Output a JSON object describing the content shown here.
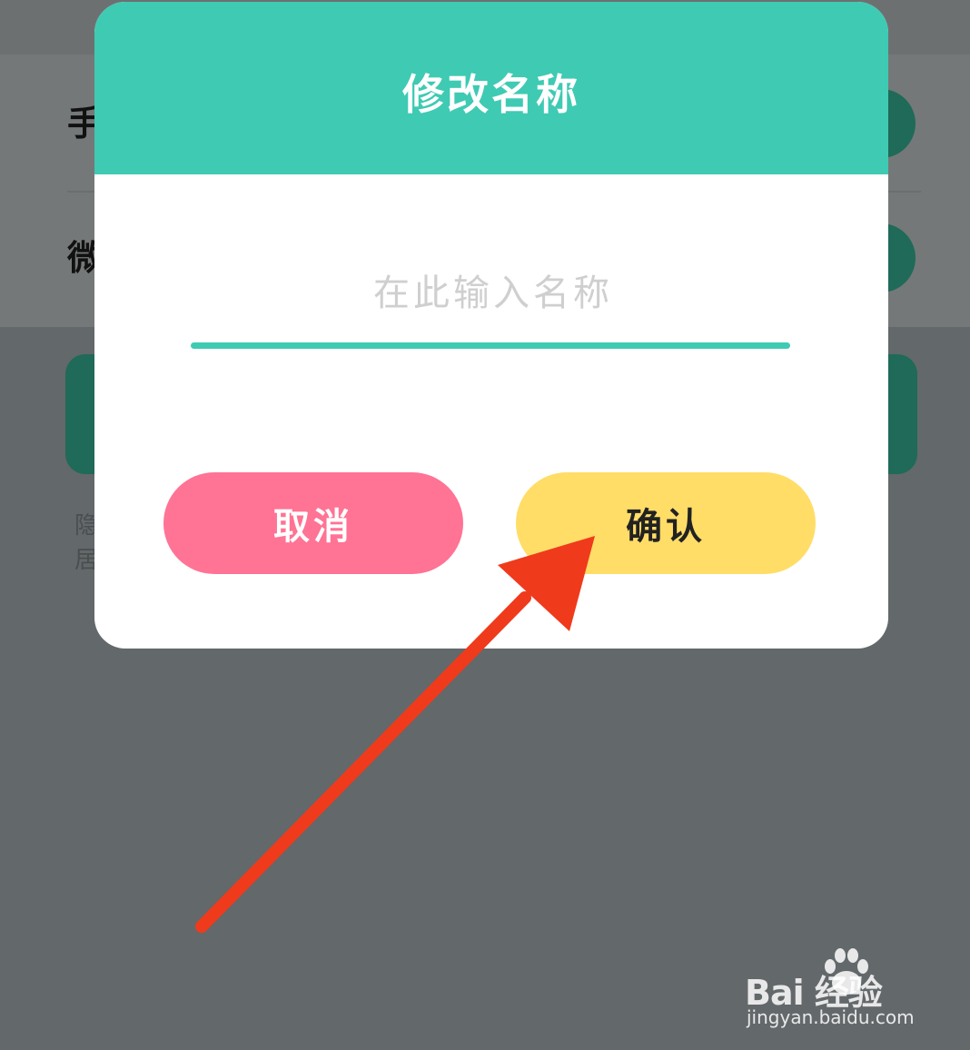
{
  "background": {
    "row_labels": [
      "手",
      "微"
    ],
    "faint_texts": [
      "隐",
      "居"
    ]
  },
  "dialog": {
    "title": "修改名称",
    "input_placeholder": "在此输入名称",
    "input_value": "",
    "cancel_label": "取消",
    "confirm_label": "确认"
  },
  "colors": {
    "header": "#3fcab3",
    "cancel": "#ff7394",
    "confirm": "#ffdd67",
    "arrow": "#f03a1c"
  },
  "watermark": {
    "logo_text": "Bai  经验",
    "url": "jingyan.baidu.com"
  }
}
